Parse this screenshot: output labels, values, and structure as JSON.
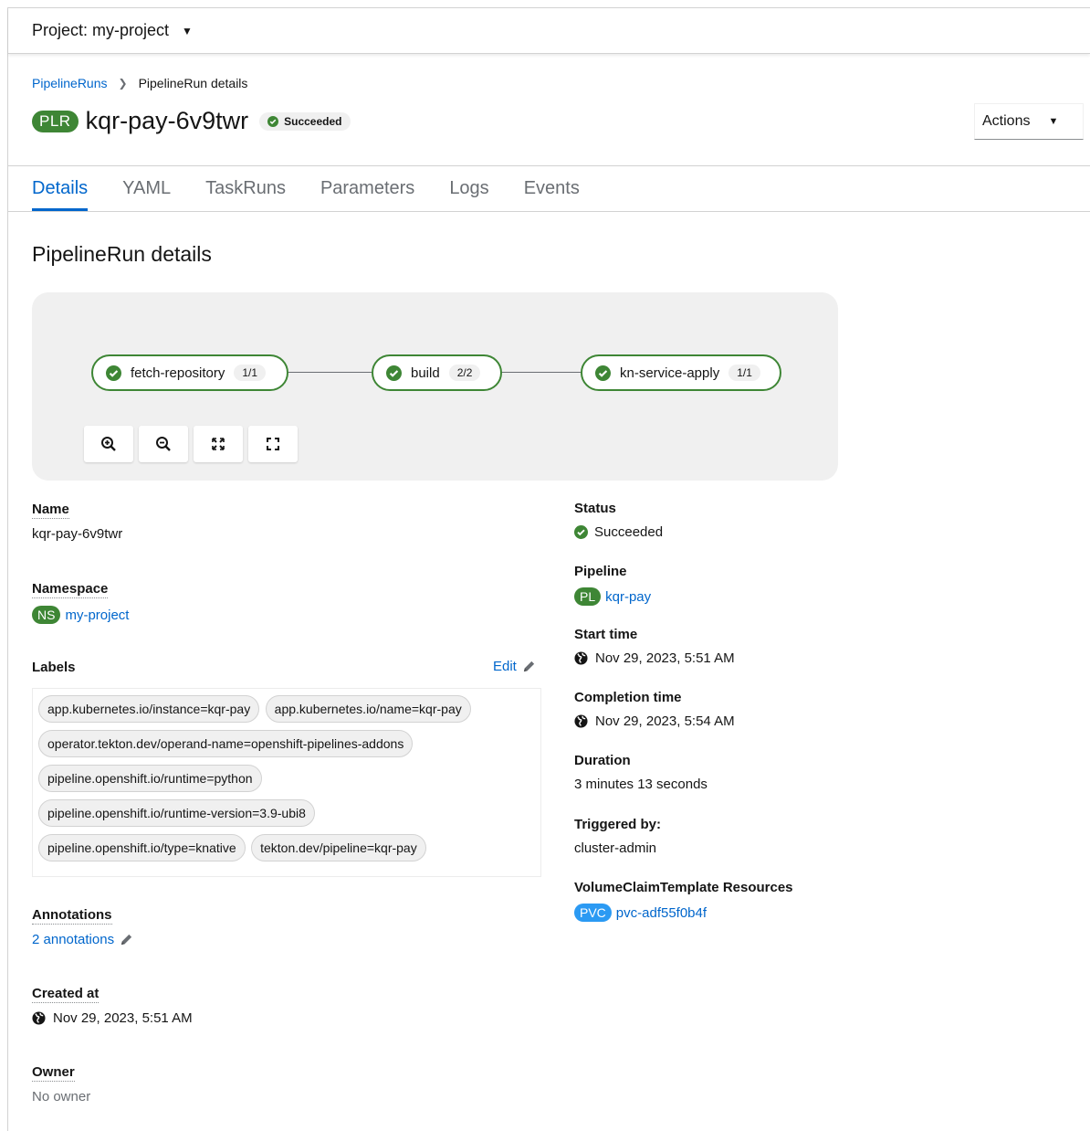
{
  "project_bar": {
    "label": "Project: my-project"
  },
  "breadcrumb": {
    "root": "PipelineRuns",
    "current": "PipelineRun details"
  },
  "header": {
    "badge": "PLR",
    "title": "kqr-pay-6v9twr",
    "status": "Succeeded",
    "actions_label": "Actions"
  },
  "tabs": [
    "Details",
    "YAML",
    "TaskRuns",
    "Parameters",
    "Logs",
    "Events"
  ],
  "section_title": "PipelineRun details",
  "topology": {
    "nodes": [
      {
        "name": "fetch-repository",
        "count": "1/1"
      },
      {
        "name": "build",
        "count": "2/2"
      },
      {
        "name": "kn-service-apply",
        "count": "1/1"
      }
    ],
    "controls": [
      "zoom-in-icon",
      "zoom-out-icon",
      "fit-to-screen-icon",
      "reset-view-icon"
    ]
  },
  "left": {
    "name_label": "Name",
    "name_value": "kqr-pay-6v9twr",
    "namespace_label": "Namespace",
    "namespace_badge": "NS",
    "namespace_value": "my-project",
    "labels_label": "Labels",
    "labels_edit": "Edit",
    "labels": [
      "app.kubernetes.io/instance=kqr-pay",
      "app.kubernetes.io/name=kqr-pay",
      "operator.tekton.dev/operand-name=openshift-pipelines-addons",
      "pipeline.openshift.io/runtime=python",
      "pipeline.openshift.io/runtime-version=3.9-ubi8",
      "pipeline.openshift.io/type=knative",
      "tekton.dev/pipeline=kqr-pay"
    ],
    "annotations_label": "Annotations",
    "annotations_value": "2 annotations",
    "created_label": "Created at",
    "created_value": "Nov 29, 2023, 5:51 AM",
    "owner_label": "Owner",
    "owner_value": "No owner"
  },
  "right": {
    "status_label": "Status",
    "status_value": "Succeeded",
    "pipeline_label": "Pipeline",
    "pipeline_badge": "PL",
    "pipeline_value": "kqr-pay",
    "start_label": "Start time",
    "start_value": "Nov 29, 2023, 5:51 AM",
    "completion_label": "Completion time",
    "completion_value": "Nov 29, 2023, 5:54 AM",
    "duration_label": "Duration",
    "duration_value": "3 minutes 13 seconds",
    "triggered_label": "Triggered by:",
    "triggered_value": "cluster-admin",
    "vct_label": "VolumeClaimTemplate Resources",
    "vct_badge": "PVC",
    "vct_value": "pvc-adf55f0b4f"
  },
  "colors": {
    "success": "#3e8635",
    "link": "#0066cc",
    "pvc_badge": "#2b9af3"
  }
}
